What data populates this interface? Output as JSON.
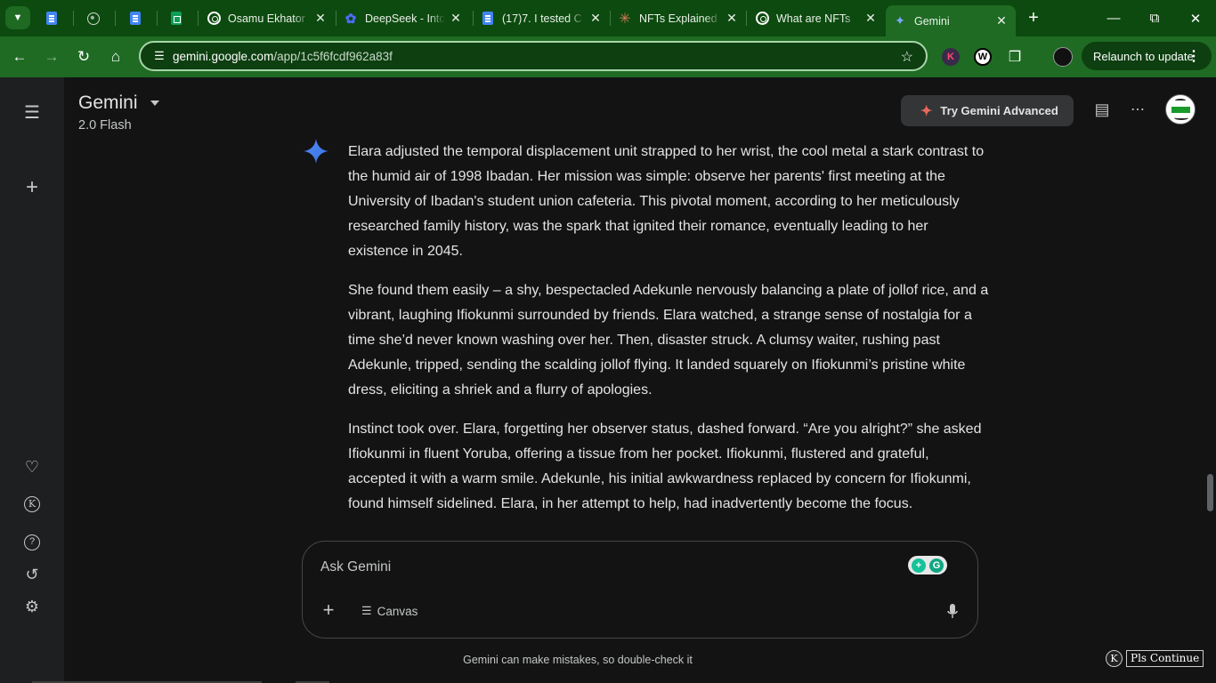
{
  "browser": {
    "tabs": [
      {
        "title": "",
        "favicon": "docs-icon"
      },
      {
        "title": "",
        "favicon": "globe-icon"
      },
      {
        "title": "",
        "favicon": "docs-icon"
      },
      {
        "title": "",
        "favicon": "sheets-icon"
      },
      {
        "title": "Osamu Ekhator",
        "favicon": "openai-icon"
      },
      {
        "title": "DeepSeek - Into",
        "favicon": "deepseek-icon"
      },
      {
        "title": "(17)7. I tested C",
        "favicon": "docs-icon"
      },
      {
        "title": "NFTs Explained",
        "favicon": "claude-icon"
      },
      {
        "title": "What are NFTs",
        "favicon": "openai-icon"
      },
      {
        "title": "Gemini",
        "favicon": "gemini-icon",
        "active": true
      }
    ],
    "url_host": "gemini.google.com",
    "url_path": "/app/1c5f6fcdf962a83f",
    "relaunch_label": "Relaunch to update",
    "theme_color": "#1f6b24"
  },
  "app": {
    "name": "Gemini",
    "model": "2.0 Flash",
    "try_advanced": "Try Gemini Advanced",
    "accent": "#4285f4"
  },
  "response": {
    "paragraphs": [
      "Elara adjusted the temporal displacement unit strapped to her wrist, the cool metal a stark contrast to the humid air of 1998 Ibadan. Her mission was simple: observe her parents' first meeting at the University of Ibadan's student union cafeteria. This pivotal moment, according to her meticulously researched family history, was the spark that ignited their romance, eventually leading to her existence in 2045.",
      "She found them easily – a shy, bespectacled Adekunle nervously balancing a plate of jollof rice, and a vibrant, laughing Ifiokunmi surrounded by friends. Elara watched, a strange sense of nostalgia for a time she’d never known washing over her. Then, disaster struck. A clumsy waiter, rushing past Adekunle, tripped, sending the scalding jollof flying. It landed squarely on Ifiokunmi’s pristine white dress, eliciting a shriek and a flurry of apologies.",
      "Instinct took over. Elara, forgetting her observer status, dashed forward. “Are you alright?” she asked Ifiokunmi in fluent Yoruba, offering a tissue from her pocket. Ifiokunmi, flustered and grateful, accepted it with a warm smile. Adekunle, his initial awkwardness replaced by concern for Ifiokunmi, found himself sidelined. Elara, in her attempt to help, had inadvertently become the focus."
    ]
  },
  "composer": {
    "placeholder": "Ask Gemini",
    "canvas_label": "Canvas"
  },
  "footer": {
    "disclaimer": "Gemini can make mistakes, so double-check it",
    "pls_continue": "Pls Continue",
    "k_badge": "K"
  }
}
